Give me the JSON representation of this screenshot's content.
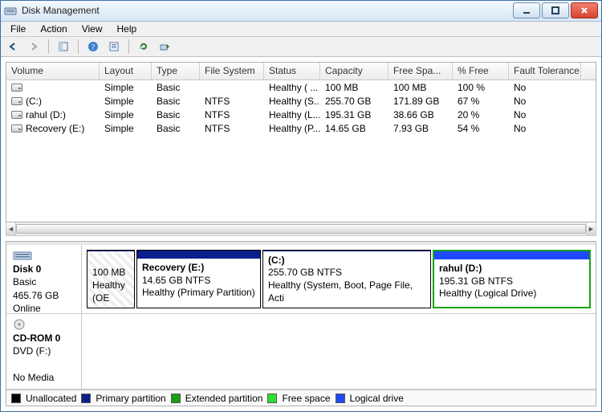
{
  "window": {
    "title": "Disk Management"
  },
  "menu": {
    "file": "File",
    "action": "Action",
    "view": "View",
    "help": "Help"
  },
  "columns": {
    "volume": "Volume",
    "layout": "Layout",
    "type": "Type",
    "fs": "File System",
    "status": "Status",
    "capacity": "Capacity",
    "free": "Free Spa...",
    "pfree": "% Free",
    "fault": "Fault Tolerance"
  },
  "volumes": [
    {
      "name": "",
      "layout": "Simple",
      "type": "Basic",
      "fs": "",
      "status": "Healthy ( ...",
      "capacity": "100 MB",
      "free": "100 MB",
      "pfree": "100 %",
      "fault": "No"
    },
    {
      "name": "(C:)",
      "layout": "Simple",
      "type": "Basic",
      "fs": "NTFS",
      "status": "Healthy (S...",
      "capacity": "255.70 GB",
      "free": "171.89 GB",
      "pfree": "67 %",
      "fault": "No"
    },
    {
      "name": "rahul (D:)",
      "layout": "Simple",
      "type": "Basic",
      "fs": "NTFS",
      "status": "Healthy (L...",
      "capacity": "195.31 GB",
      "free": "38.66 GB",
      "pfree": "20 %",
      "fault": "No"
    },
    {
      "name": "Recovery (E:)",
      "layout": "Simple",
      "type": "Basic",
      "fs": "NTFS",
      "status": "Healthy (P...",
      "capacity": "14.65 GB",
      "free": "7.93 GB",
      "pfree": "54 %",
      "fault": "No"
    }
  ],
  "legend": {
    "unallocated": "Unallocated",
    "primary": "Primary partition",
    "extended": "Extended partition",
    "free": "Free space",
    "logical": "Logical drive"
  },
  "disk0": {
    "label": "Disk 0",
    "type": "Basic",
    "size": "465.76 GB",
    "state": "Online",
    "oem": {
      "size_line": "100 MB",
      "status": "Healthy (OE"
    },
    "recovery": {
      "name": "Recovery  (E:)",
      "size_line": "14.65 GB NTFS",
      "status": "Healthy (Primary Partition)"
    },
    "c": {
      "name": "(C:)",
      "size_line": "255.70 GB NTFS",
      "status": "Healthy (System, Boot, Page File, Acti"
    },
    "d": {
      "name": "rahul  (D:)",
      "size_line": "195.31 GB NTFS",
      "status": "Healthy (Logical Drive)"
    }
  },
  "cdrom": {
    "label": "CD-ROM 0",
    "type": "DVD (F:)",
    "state": "No Media"
  }
}
